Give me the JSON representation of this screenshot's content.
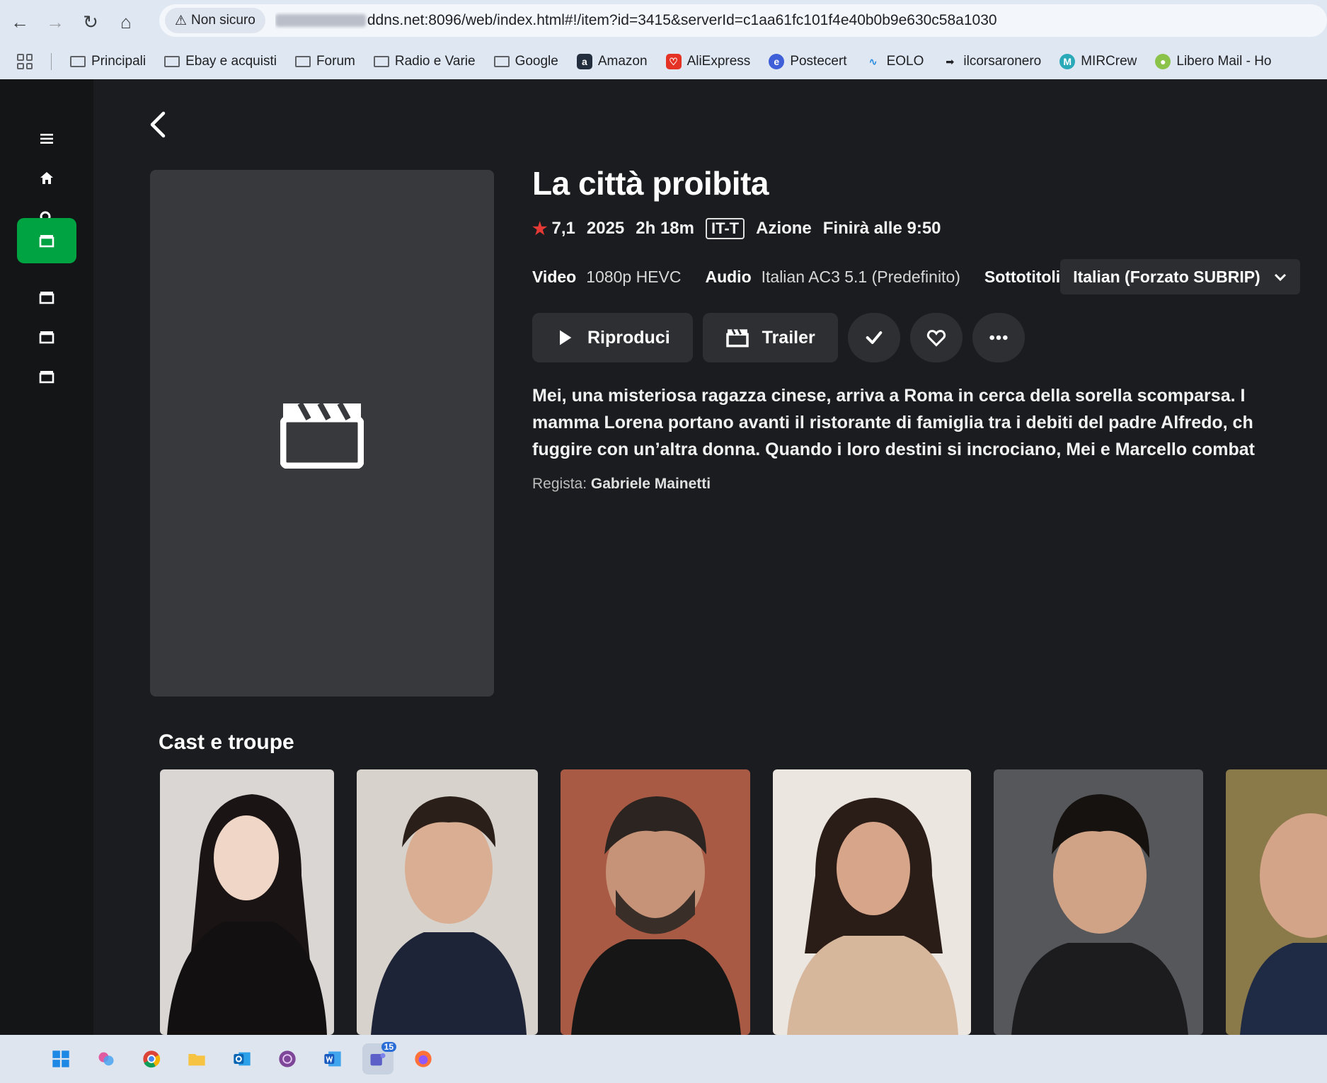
{
  "browser": {
    "security_label": "Non sicuro",
    "url": "ddns.net:8096/web/index.html#!/item?id=3415&serverId=c1aa61fc101f4e40b0b9e630c58a1030",
    "bookmarks": [
      {
        "label": "Principali",
        "icon": "folder-icon"
      },
      {
        "label": "Ebay e acquisti",
        "icon": "folder-icon"
      },
      {
        "label": "Forum",
        "icon": "folder-icon"
      },
      {
        "label": "Radio e Varie",
        "icon": "folder-icon"
      },
      {
        "label": "Google",
        "icon": "folder-icon"
      },
      {
        "label": "Amazon",
        "icon": "amazon-icon"
      },
      {
        "label": "AliExpress",
        "icon": "aliexpress-icon"
      },
      {
        "label": "Postecert",
        "icon": "postecert-icon"
      },
      {
        "label": "EOLO",
        "icon": "eolo-icon"
      },
      {
        "label": "ilcorsaronero",
        "icon": "ilcorsaronero-icon"
      },
      {
        "label": "MIRCrew",
        "icon": "mircrew-icon"
      },
      {
        "label": "Libero Mail - Ho",
        "icon": "libero-icon"
      }
    ]
  },
  "sidenav": {
    "items": [
      "menu-icon",
      "home-icon",
      "search-icon",
      "movies-icon",
      "library-icon",
      "library-icon",
      "library-icon"
    ],
    "active_index": 3,
    "accent": "#00a341"
  },
  "item": {
    "title": "La città proibita",
    "rating": "7,1",
    "year": "2025",
    "runtime": "2h 18m",
    "parental": "IT-T",
    "genre": "Azione",
    "ends_at": "Finirà alle 9:50",
    "video_label": "Video",
    "video_value": "1080p HEVC",
    "audio_label": "Audio",
    "audio_value": "Italian AC3 5.1 (Predefinito)",
    "subs_label": "Sottotitoli",
    "subs_value": "Italian (Forzato SUBRIP)",
    "play_label": "Riproduci",
    "trailer_label": "Trailer",
    "overview_lines": [
      "Mei, una misteriosa ragazza cinese, arriva a Roma in cerca della sorella scomparsa. I",
      "mamma Lorena portano avanti il ristorante di famiglia tra i debiti del padre Alfredo, ch",
      "fuggire con un’altra donna.  Quando i loro destini si incrociano, Mei e Marcello combat"
    ],
    "director_label": "Regista:",
    "director_name": "Gabriele Mainetti"
  },
  "cast": {
    "heading": "Cast e troupe"
  },
  "taskbar": {
    "icons": [
      "windows-start-icon",
      "copilot-icon",
      "chrome-icon",
      "file-explorer-icon",
      "outlook-icon",
      "tor-icon",
      "word-icon",
      "teams-icon",
      "firefox-icon"
    ],
    "badge_count": "15"
  }
}
